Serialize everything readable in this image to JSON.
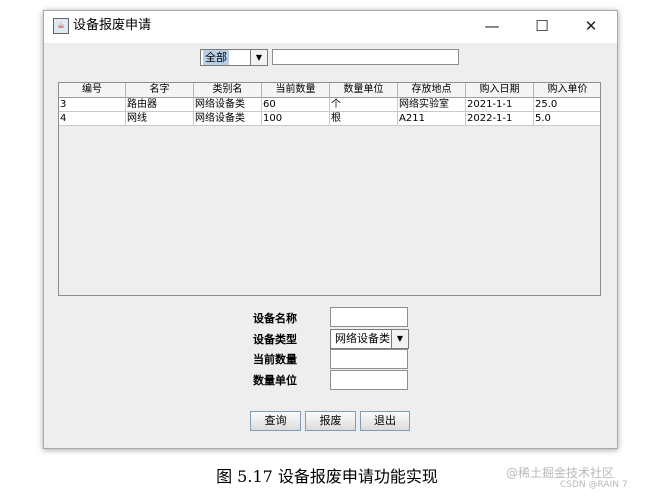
{
  "window": {
    "title": "设备报废申请",
    "controls": [
      "—",
      "☐",
      "✕"
    ]
  },
  "filter": {
    "category": "全部",
    "search_value": ""
  },
  "table": {
    "columns": [
      "编号",
      "名字",
      "类别名",
      "当前数量",
      "数量单位",
      "存放地点",
      "购入日期",
      "购入单价"
    ],
    "rows": [
      [
        "3",
        "路由器",
        "网络设备类",
        "60",
        "个",
        "网络实验室",
        "2021-1-1",
        "25.0"
      ],
      [
        "4",
        "网线",
        "网络设备类",
        "100",
        "根",
        "A211",
        "2022-1-1",
        "5.0"
      ]
    ]
  },
  "form": {
    "name_label": "设备名称",
    "name_value": "",
    "type_label": "设备类型",
    "type_value": "网络设备类",
    "quantity_label": "当前数量",
    "quantity_value": "",
    "unit_label": "数量单位",
    "unit_value": ""
  },
  "buttons": {
    "query": "查询",
    "scrap": "报废",
    "exit": "退出"
  },
  "caption": "图 5.17 设备报废申请功能实现",
  "watermark": {
    "line1": "@稀土掘金技术社区",
    "line2": "CSDN @RAIN 7"
  }
}
